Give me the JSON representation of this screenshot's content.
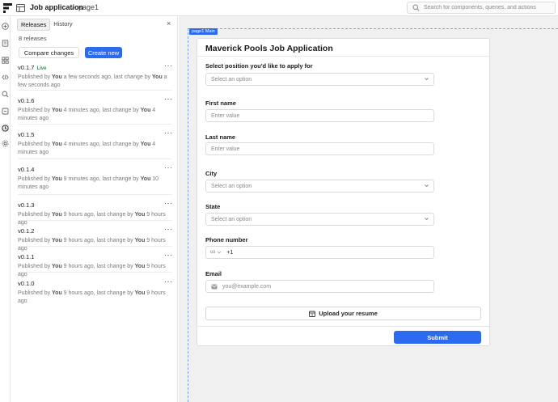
{
  "topbar": {
    "app_name": "Job application",
    "separator": "/",
    "page_name": "page1",
    "search_placeholder": "Search for components, queries, and actions"
  },
  "rail": {
    "icons": [
      "add-icon",
      "pages-icon",
      "components-icon",
      "code-icon",
      "search-icon",
      "debug-icon",
      "history-icon",
      "settings-icon"
    ]
  },
  "releases_panel": {
    "tabs": [
      "Releases",
      "History"
    ],
    "active_tab": "Releases",
    "close": "×",
    "count": "8 releases",
    "compare_label": "Compare changes",
    "create_label": "Create new",
    "releases": [
      {
        "version": "v0.1.7",
        "badge": "Live",
        "pub_pre": "Published by ",
        "pub_by": "You",
        "pub_when": " a few seconds ago, last change by ",
        "chg_by": "You",
        "chg_when": " a few seconds ago"
      },
      {
        "version": "v0.1.6",
        "badge": "",
        "pub_pre": "Published by ",
        "pub_by": "You",
        "pub_when": " 4 minutes ago, last change by ",
        "chg_by": "You",
        "chg_when": " 4 minutes ago"
      },
      {
        "version": "v0.1.5",
        "badge": "",
        "pub_pre": "Published by ",
        "pub_by": "You",
        "pub_when": " 4 minutes ago, last change by ",
        "chg_by": "You",
        "chg_when": " 4 minutes ago"
      },
      {
        "version": "v0.1.4",
        "badge": "",
        "pub_pre": "Published by ",
        "pub_by": "You",
        "pub_when": " 9 minutes ago, last change by ",
        "chg_by": "You",
        "chg_when": " 10 minutes ago"
      },
      {
        "version": "v0.1.3",
        "badge": "",
        "pub_pre": "Published by ",
        "pub_by": "You",
        "pub_when": " 9 hours ago, last change by ",
        "chg_by": "You",
        "chg_when": " 9 hours ago"
      },
      {
        "version": "v0.1.2",
        "badge": "",
        "pub_pre": "Published by ",
        "pub_by": "You",
        "pub_when": " 9 hours ago, last change by ",
        "chg_by": "You",
        "chg_when": " 9 hours ago"
      },
      {
        "version": "v0.1.1",
        "badge": "",
        "pub_pre": "Published by ",
        "pub_by": "You",
        "pub_when": " 9 hours ago, last change by ",
        "chg_by": "You",
        "chg_when": " 9 hours ago"
      },
      {
        "version": "v0.1.0",
        "badge": "",
        "pub_pre": "Published by ",
        "pub_by": "You",
        "pub_when": " 9 hours ago, last change by ",
        "chg_by": "You",
        "chg_when": " 9 hours ago"
      }
    ],
    "menu_glyph": "···"
  },
  "canvas": {
    "frame_label": "page1 Main",
    "form": {
      "title": "Maverick Pools Job Application",
      "position_label": "Select position you'd like to apply for",
      "position_placeholder": "Select an option",
      "first_name_label": "First name",
      "first_name_placeholder": "Enter value",
      "last_name_label": "Last name",
      "last_name_placeholder": "Enter value",
      "city_label": "City",
      "city_placeholder": "Select an option",
      "state_label": "State",
      "state_placeholder": "Select an option",
      "phone_label": "Phone number",
      "phone_country": "us",
      "phone_code": "+1",
      "email_label": "Email",
      "email_placeholder": "you@example.com",
      "upload_label": "Upload your resume",
      "submit_label": "Submit"
    }
  },
  "colors": {
    "accent": "#2c6bf0",
    "live": "#1b9a4b",
    "canvas_bg": "#f0f0f0"
  }
}
